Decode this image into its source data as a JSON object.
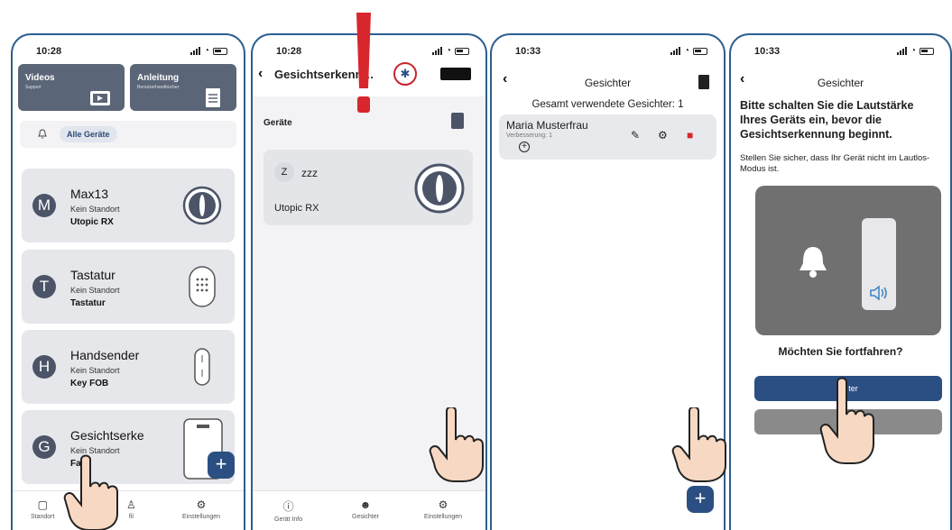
{
  "p1": {
    "time": "10:28",
    "tiles": [
      {
        "title": "Videos",
        "sub": "Support"
      },
      {
        "title": "Anleitung",
        "sub": "Benutzerhandbücher"
      }
    ],
    "filter": "Alle Geräte",
    "devices": [
      {
        "initial": "M",
        "name": "Max13",
        "loc": "Kein Standort",
        "type": "Utopic RX"
      },
      {
        "initial": "T",
        "name": "Tastatur",
        "loc": "Kein Standort",
        "type": "Tastatur"
      },
      {
        "initial": "H",
        "name": "Handsender",
        "loc": "Kein Standort",
        "type": "Key FOB"
      },
      {
        "initial": "G",
        "name": "Gesichtserke",
        "loc": "Kein Standort",
        "type": "Fa    R"
      }
    ],
    "nav": [
      "Standort",
      "fil",
      "Einstellungen"
    ]
  },
  "p2": {
    "time": "10:28",
    "title": "Gesichtserkenn…",
    "section": "Geräte",
    "device_initial": "Z",
    "device_name": "zzz",
    "device_model": "Utopic RX",
    "nav": [
      "Gerät Info",
      "Gesichter",
      "Einstellungen"
    ]
  },
  "p3": {
    "time": "10:33",
    "title": "Gesichter",
    "summary": "Gesamt verwendete Gesichter: 1",
    "face_name": "Maria Musterfrau",
    "face_sub": "Verbesserung: 1"
  },
  "p4": {
    "time": "10:33",
    "title": "Gesichter",
    "question": "Bitte schalten Sie die Lautstärke Ihres Geräts ein, bevor die Gesichtserkennung beginnt.",
    "sub": "Stellen Sie sicher, dass Ihr Gerät nicht im Lautlos-Modus ist.",
    "continue": "Möchten Sie fortfahren?",
    "btn1": "W    ter"
  },
  "colors": {
    "accent": "#2b4f82",
    "alert": "#c7252a",
    "card": "#e6e7eb"
  }
}
